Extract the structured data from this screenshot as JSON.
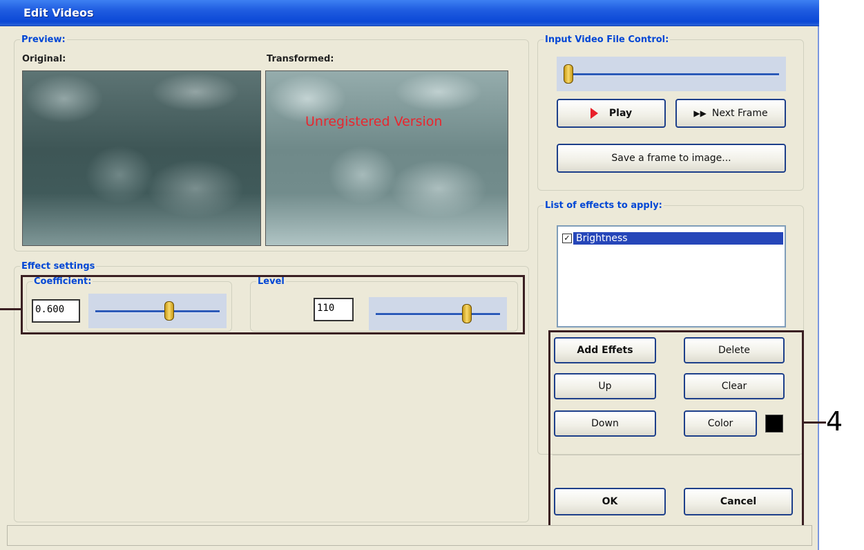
{
  "window": {
    "title": "Edit Videos"
  },
  "preview": {
    "group_label": "Preview:",
    "original_label": "Original:",
    "transformed_label": "Transformed:",
    "watermark": "Unregistered Version"
  },
  "input_control": {
    "group_label": "Input Video File Control:",
    "position": 0.0,
    "play_label": "Play",
    "next_frame_label": "Next Frame",
    "save_frame_label": "Save a frame to image..."
  },
  "effect_settings": {
    "group_label": "Effect settings",
    "coefficient": {
      "label": "Coefficient:",
      "value": "0.600",
      "slider_level": 0.6
    },
    "level": {
      "label": "Level",
      "value": "110",
      "slider_level": 0.75
    }
  },
  "effects_list": {
    "group_label": "List of effects to apply:",
    "items": [
      {
        "label": "Brightness",
        "checked": true,
        "selected": true
      }
    ]
  },
  "buttons": {
    "add": "Add Effets",
    "delete": "Delete",
    "up": "Up",
    "clear": "Clear",
    "down": "Down",
    "color": "Color",
    "ok": "OK",
    "cancel": "Cancel"
  },
  "color_swatch": "#000000",
  "callouts": {
    "four": "4"
  },
  "icons": {
    "play": "play-triangle-icon",
    "next_frame": "fast-forward-icon"
  }
}
